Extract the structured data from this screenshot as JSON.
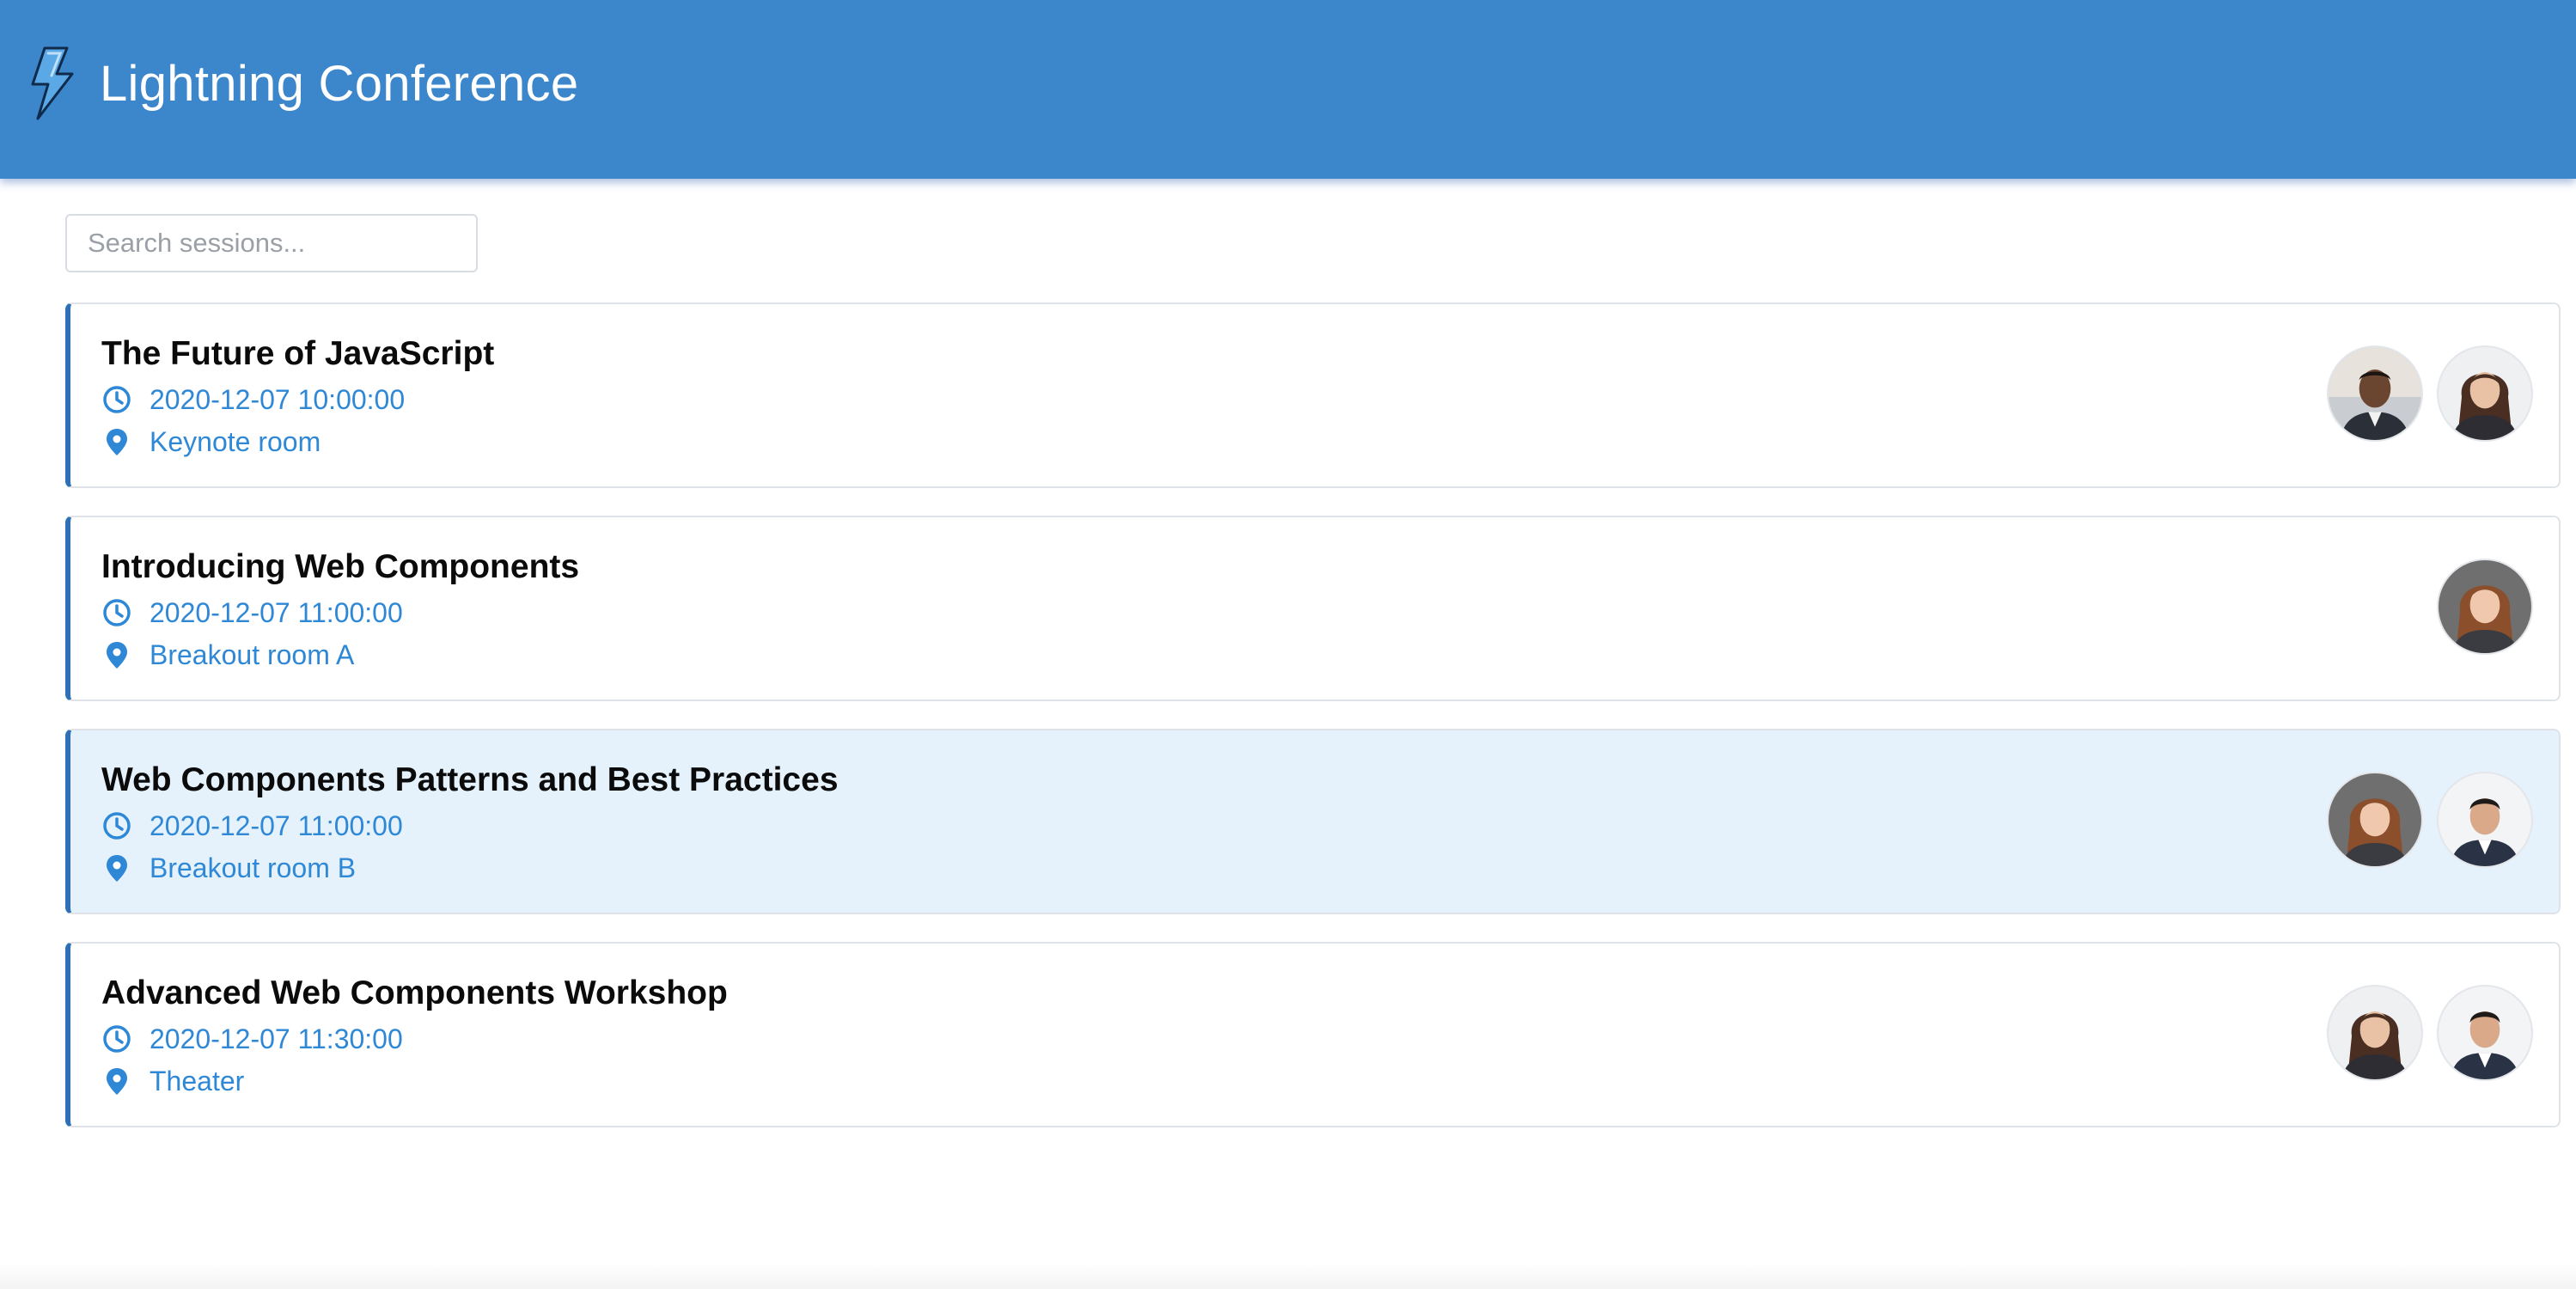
{
  "app": {
    "title": "Lightning Conference",
    "logo_icon": "lightning-bolt-icon",
    "accent_color": "#3c86cb",
    "link_color": "#2f88d6"
  },
  "search": {
    "placeholder": "Search sessions...",
    "value": ""
  },
  "sessions": [
    {
      "title": "The Future of JavaScript",
      "datetime": "2020-12-07 10:00:00",
      "room": "Keynote room",
      "speakers": [
        {
          "avatar": "avatar-man-dark-hair"
        },
        {
          "avatar": "avatar-woman-dark-hair"
        }
      ]
    },
    {
      "title": "Introducing Web Components",
      "datetime": "2020-12-07 11:00:00",
      "room": "Breakout room A",
      "speakers": [
        {
          "avatar": "avatar-woman-auburn-hair"
        }
      ]
    },
    {
      "title": "Web Components Patterns and Best Practices",
      "datetime": "2020-12-07 11:00:00",
      "room": "Breakout room B",
      "selected": true,
      "speakers": [
        {
          "avatar": "avatar-woman-auburn-hair"
        },
        {
          "avatar": "avatar-man-short-hair"
        }
      ]
    },
    {
      "title": "Advanced Web Components Workshop",
      "datetime": "2020-12-07 11:30:00",
      "room": "Theater",
      "speakers": [
        {
          "avatar": "avatar-woman-dark-hair"
        },
        {
          "avatar": "avatar-man-short-hair"
        }
      ]
    }
  ]
}
